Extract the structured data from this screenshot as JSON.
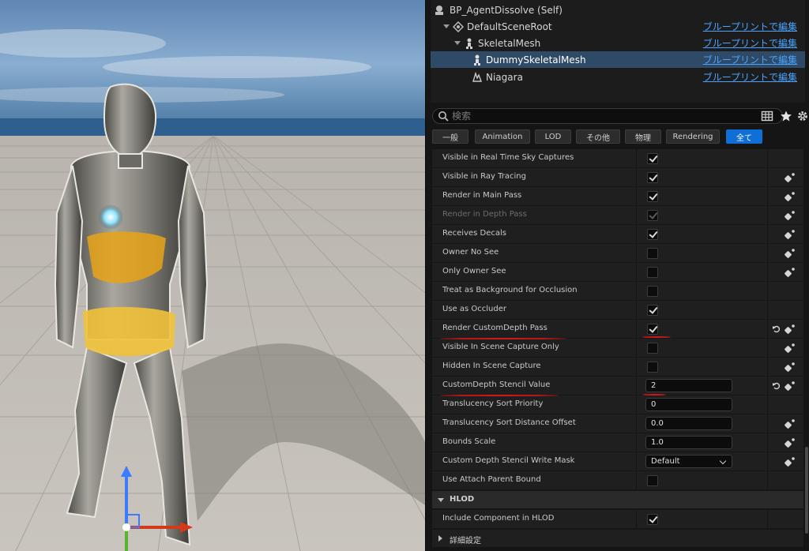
{
  "components": {
    "items": [
      {
        "label": "BP_AgentDissolve (Self)",
        "icon": "blueprint-self-icon",
        "edit": ""
      },
      {
        "label": "DefaultSceneRoot",
        "icon": "scene-root-icon",
        "edit": "ブループリントで編集"
      },
      {
        "label": "SkeletalMesh",
        "icon": "skeletal-mesh-icon",
        "edit": "ブループリントで編集"
      },
      {
        "label": "DummySkeletalMesh",
        "icon": "skeletal-mesh-icon",
        "edit": "ブループリントで編集"
      },
      {
        "label": "Niagara",
        "icon": "niagara-icon",
        "edit": "ブループリントで編集"
      }
    ]
  },
  "search": {
    "placeholder": "検索"
  },
  "tabs": [
    "一般",
    "Animation",
    "LOD",
    "その他",
    "物理",
    "Rendering",
    "全て"
  ],
  "active_tab": "全て",
  "properties": [
    {
      "name": "Visible in Real Time Sky Captures",
      "type": "checkbox",
      "checked": true
    },
    {
      "name": "Visible in Ray Tracing",
      "type": "checkbox",
      "checked": true
    },
    {
      "name": "Render in Main Pass",
      "type": "checkbox",
      "checked": true
    },
    {
      "name": "Render in Depth Pass",
      "type": "checkbox",
      "checked": true,
      "disabled": true
    },
    {
      "name": "Receives Decals",
      "type": "checkbox",
      "checked": true
    },
    {
      "name": "Owner No See",
      "type": "checkbox",
      "checked": false
    },
    {
      "name": "Only Owner See",
      "type": "checkbox",
      "checked": false
    },
    {
      "name": "Treat as Background for Occlusion",
      "type": "checkbox",
      "checked": false
    },
    {
      "name": "Use as Occluder",
      "type": "checkbox",
      "checked": true
    },
    {
      "name": "Render CustomDepth Pass",
      "type": "checkbox",
      "checked": true
    },
    {
      "name": "Visible In Scene Capture Only",
      "type": "checkbox",
      "checked": false
    },
    {
      "name": "Hidden In Scene Capture",
      "type": "checkbox",
      "checked": false
    },
    {
      "name": "CustomDepth Stencil Value",
      "type": "number",
      "value": "2"
    },
    {
      "name": "Translucency Sort Priority",
      "type": "number",
      "value": "0"
    },
    {
      "name": "Translucency Sort Distance Offset",
      "type": "number",
      "value": "0.0"
    },
    {
      "name": "Bounds Scale",
      "type": "number",
      "value": "1.0"
    },
    {
      "name": "Custom Depth Stencil Write Mask",
      "type": "dropdown",
      "value": "Default"
    },
    {
      "name": "Use Attach Parent Bound",
      "type": "checkbox",
      "checked": false
    }
  ],
  "hlod": {
    "title": "HLOD",
    "property": {
      "name": "Include Component in HLOD",
      "type": "checkbox",
      "checked": true
    }
  },
  "advanced": {
    "title": "詳細設定"
  },
  "colors": {
    "accent": "#0f6fd6",
    "link": "#4aa3ff",
    "annotation": "#d01818",
    "selection": "#2f4a66"
  }
}
